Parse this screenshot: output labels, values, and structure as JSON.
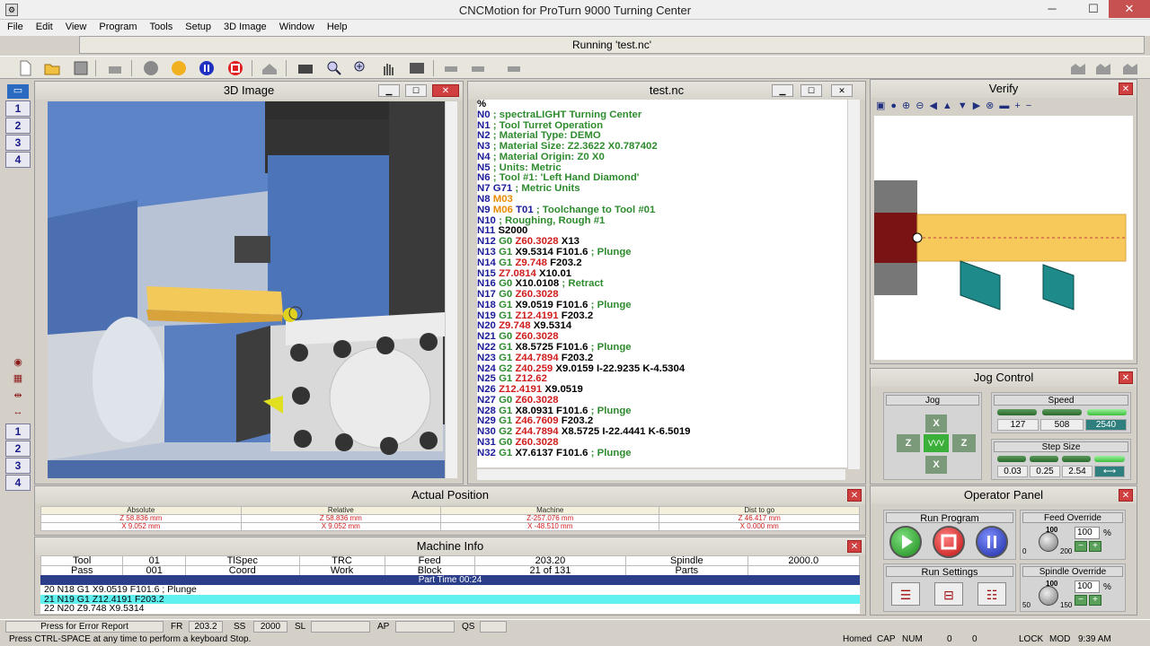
{
  "window": {
    "title": "CNCMotion for ProTurn 9000 Turning Center",
    "minimize": "─",
    "maximize": "☐",
    "close": "✕"
  },
  "menu": [
    "File",
    "Edit",
    "View",
    "Program",
    "Tools",
    "Setup",
    "3D Image",
    "Window",
    "Help"
  ],
  "status_strip": {
    "text": "Running 'test.nc'"
  },
  "left_rail": {
    "top_numbers": [
      "1",
      "2",
      "3",
      "4"
    ],
    "bottom_numbers": [
      "1",
      "2",
      "3",
      "4"
    ]
  },
  "image3d": {
    "title": "3D Image"
  },
  "code_window": {
    "title": "test.nc",
    "lines": [
      [
        [
          "%",
          "k"
        ]
      ],
      [
        [
          "N0",
          "b"
        ],
        [
          " ; spectraLIGHT Turning Center",
          "g"
        ]
      ],
      [
        [
          "N1",
          "b"
        ],
        [
          " ; Tool Turret Operation",
          "g"
        ]
      ],
      [
        [
          "N2",
          "b"
        ],
        [
          " ; Material Type: DEMO",
          "g"
        ]
      ],
      [
        [
          "N3",
          "b"
        ],
        [
          " ; Material Size: Z2.3622 X0.787402",
          "g"
        ]
      ],
      [
        [
          "N4",
          "b"
        ],
        [
          " ; Material Origin: Z0 X0",
          "g"
        ]
      ],
      [
        [
          "N5",
          "b"
        ],
        [
          " ; Units: Metric",
          "g"
        ]
      ],
      [
        [
          "N6",
          "b"
        ],
        [
          " ; Tool #1: 'Left Hand Diamond'",
          "g"
        ]
      ],
      [
        [
          "N7",
          "b"
        ],
        [
          " G71",
          "b"
        ],
        [
          " ; Metric Units",
          "g"
        ]
      ],
      [
        [
          "N8",
          "b"
        ],
        [
          " M03",
          "o"
        ]
      ],
      [
        [
          "N9",
          "b"
        ],
        [
          " M06",
          "o"
        ],
        [
          " T01",
          "b"
        ],
        [
          " ; Toolchange to Tool #01",
          "g"
        ]
      ],
      [
        [
          "N10",
          "b"
        ],
        [
          " ; Roughing, Rough #1",
          "g"
        ]
      ],
      [
        [
          "N11",
          "b"
        ],
        [
          " S2000",
          "k"
        ]
      ],
      [
        [
          "N12",
          "b"
        ],
        [
          " G0",
          "g"
        ],
        [
          " Z60.3028",
          "r"
        ],
        [
          " X13",
          "k"
        ]
      ],
      [
        [
          "N13",
          "b"
        ],
        [
          " G1",
          "g"
        ],
        [
          " X9.5314 F101.6",
          "k"
        ],
        [
          " ; Plunge",
          "g"
        ]
      ],
      [
        [
          "N14",
          "b"
        ],
        [
          " G1",
          "g"
        ],
        [
          " Z9.748",
          "r"
        ],
        [
          " F203.2",
          "k"
        ]
      ],
      [
        [
          "N15",
          "b"
        ],
        [
          " Z7.0814",
          "r"
        ],
        [
          " X10.01",
          "k"
        ]
      ],
      [
        [
          "N16",
          "b"
        ],
        [
          " G0",
          "g"
        ],
        [
          " X10.0108",
          "k"
        ],
        [
          " ; Retract",
          "g"
        ]
      ],
      [
        [
          "N17",
          "b"
        ],
        [
          " G0",
          "g"
        ],
        [
          " Z60.3028",
          "r"
        ]
      ],
      [
        [
          "N18",
          "b"
        ],
        [
          " G1",
          "g"
        ],
        [
          " X9.0519 F101.6",
          "k"
        ],
        [
          " ; Plunge",
          "g"
        ]
      ],
      [
        [
          "N19",
          "b"
        ],
        [
          " G1",
          "g"
        ],
        [
          " Z12.4191",
          "r"
        ],
        [
          " F203.2",
          "k"
        ]
      ],
      [
        [
          "N20",
          "b"
        ],
        [
          " Z9.748",
          "r"
        ],
        [
          " X9.5314",
          "k"
        ]
      ],
      [
        [
          "N21",
          "b"
        ],
        [
          " G0",
          "g"
        ],
        [
          " Z60.3028",
          "r"
        ]
      ],
      [
        [
          "N22",
          "b"
        ],
        [
          " G1",
          "g"
        ],
        [
          " X8.5725 F101.6",
          "k"
        ],
        [
          " ; Plunge",
          "g"
        ]
      ],
      [
        [
          "N23",
          "b"
        ],
        [
          " G1",
          "g"
        ],
        [
          " Z44.7894",
          "r"
        ],
        [
          " F203.2",
          "k"
        ]
      ],
      [
        [
          "N24",
          "b"
        ],
        [
          " G2",
          "g"
        ],
        [
          " Z40.259",
          "r"
        ],
        [
          " X9.0159 I-22.9235 K-4.5304",
          "k"
        ]
      ],
      [
        [
          "N25",
          "b"
        ],
        [
          " G1",
          "g"
        ],
        [
          " Z12.62",
          "r"
        ]
      ],
      [
        [
          "N26",
          "b"
        ],
        [
          " Z12.4191",
          "r"
        ],
        [
          " X9.0519",
          "k"
        ]
      ],
      [
        [
          "N27",
          "b"
        ],
        [
          " G0",
          "g"
        ],
        [
          " Z60.3028",
          "r"
        ]
      ],
      [
        [
          "N28",
          "b"
        ],
        [
          " G1",
          "g"
        ],
        [
          " X8.0931 F101.6",
          "k"
        ],
        [
          " ; Plunge",
          "g"
        ]
      ],
      [
        [
          "N29",
          "b"
        ],
        [
          " G1",
          "g"
        ],
        [
          " Z46.7609",
          "r"
        ],
        [
          " F203.2",
          "k"
        ]
      ],
      [
        [
          "N30",
          "b"
        ],
        [
          " G2",
          "g"
        ],
        [
          " Z44.7894",
          "r"
        ],
        [
          " X8.5725 I-22.4441 K-6.5019",
          "k"
        ]
      ],
      [
        [
          "N31",
          "b"
        ],
        [
          " G0",
          "g"
        ],
        [
          " Z60.3028",
          "r"
        ]
      ],
      [
        [
          "N32",
          "b"
        ],
        [
          " G1",
          "g"
        ],
        [
          " X7.6137 F101.6",
          "k"
        ],
        [
          " ; Plunge",
          "g"
        ]
      ]
    ]
  },
  "verify": {
    "title": "Verify"
  },
  "jog": {
    "title": "Jog Control",
    "jog_label": "Jog",
    "x_up": "X",
    "x_down": "X",
    "z_left": "Z",
    "z_right": "Z",
    "center": "VVV",
    "speed_label": "Speed",
    "speed_values": [
      "127",
      "508",
      "2540"
    ],
    "step_label": "Step Size",
    "step_values": [
      "0.03",
      "0.25",
      "2.54"
    ]
  },
  "actual_position": {
    "title": "Actual Position",
    "headers": [
      "Absolute",
      "Relative",
      "Machine",
      "Dist to go"
    ],
    "z_row": [
      "Z  58.836 mm",
      "Z  58.836 mm",
      "Z-257.076 mm",
      "Z  46.417 mm"
    ],
    "x_row": [
      "X   9.052 mm",
      "X   9.052 mm",
      "X  -48.510 mm",
      "X   0.000 mm"
    ]
  },
  "machine_info": {
    "title": "Machine Info",
    "row1": [
      "Tool",
      "01",
      "TlSpec",
      "TRC",
      "Feed",
      "203.20",
      "Spindle",
      "2000.0"
    ],
    "row2": [
      "Pass",
      "001",
      "Coord",
      "Work",
      "Block",
      "21 of 131",
      "Parts",
      ""
    ],
    "part_time": "Part Time 00:24",
    "lines": [
      "20 N18 G1 X9.0519 F101.6 ; Plunge",
      "21 N19 G1 Z12.4191 F203.2",
      "22 N20 Z9.748 X9.5314"
    ]
  },
  "operator_panel": {
    "title": "Operator Panel",
    "run_program": "Run Program",
    "feed_override": "Feed Override",
    "feed_scale": [
      "100",
      "0",
      "200"
    ],
    "feed_value": "100",
    "run_settings": "Run Settings",
    "spindle_override": "Spindle Override",
    "spindle_scale": [
      "100",
      "50",
      "150"
    ],
    "spindle_value": "100",
    "percent": "%"
  },
  "status_bar": {
    "error_report": "Press for Error Report",
    "fr_label": "FR",
    "fr_value": "203.2",
    "ss_label": "SS",
    "ss_value": "2000",
    "sl_label": "SL",
    "ap_label": "AP",
    "qs_label": "QS",
    "hint": "Press CTRL-SPACE at any time to perform a keyboard Stop.",
    "homed": "Homed",
    "cap": "CAP",
    "num": "NUM",
    "coord_a": "0",
    "coord_b": "0",
    "lock": "LOCK",
    "mod": "MOD",
    "time": "9:39 AM"
  },
  "colors": {
    "accent_blue": "#1a1a8a",
    "code_green": "#2e8b2e",
    "code_red": "#d01c1c",
    "highlight_cyan": "#5ff0f0",
    "stock_yellow": "#f7c95a",
    "chuck_red": "#7a1414",
    "tool_teal": "#1e8a8a"
  }
}
